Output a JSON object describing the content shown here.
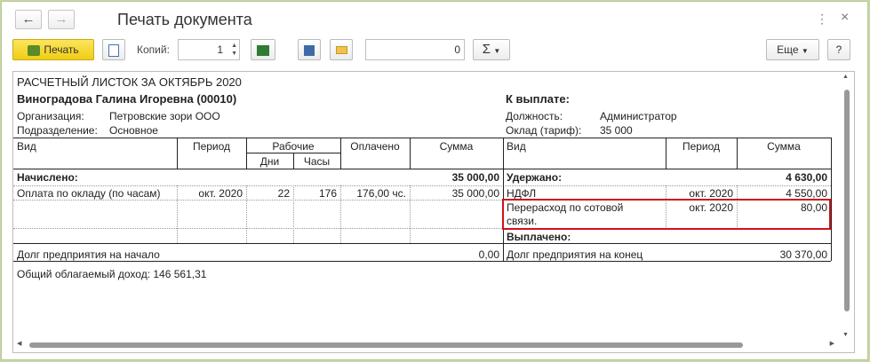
{
  "window": {
    "title": "Печать документа",
    "more_icon": "⋮",
    "close_icon": "×"
  },
  "toolbar": {
    "print_label": "Печать",
    "copies_label": "Копий:",
    "copies_value": "1",
    "sum_value": "0",
    "sigma_label": "Σ",
    "more_label": "Еще",
    "help_label": "?"
  },
  "doc": {
    "title": "РАСЧЕТНЫЙ ЛИСТОК ЗА ОКТЯБРЬ 2020",
    "employee": "Виноградова Галина Игоревна (00010)",
    "to_pay_label": "К выплате:",
    "org_label": "Организация:",
    "org_value": "Петровские зори ООО",
    "dept_label": "Подразделение:",
    "dept_value": "Основное",
    "position_label": "Должность:",
    "position_value": "Администратор",
    "salary_label": "Оклад (тариф):",
    "salary_value": "35 000",
    "headers": {
      "vid": "Вид",
      "period": "Период",
      "work": "Рабочие",
      "days": "Дни",
      "hours": "Часы",
      "paid": "Оплачено",
      "sum": "Сумма",
      "vid2": "Вид",
      "period2": "Период",
      "sum2": "Сумма"
    },
    "accrued_label": "Начислено:",
    "accrued_total": "35 000,00",
    "withheld_label": "Удержано:",
    "withheld_total": "4 630,00",
    "accrual_row": {
      "vid": "Оплата по окладу (по часам)",
      "period": "окт. 2020",
      "days": "22",
      "hours": "176",
      "paid": "176,00 чс.",
      "sum": "35 000,00"
    },
    "withhold_rows": [
      {
        "vid": "НДФЛ",
        "period": "окт. 2020",
        "sum": "4 550,00"
      },
      {
        "vid": "Перерасход по сотовой",
        "vid2": "связи.",
        "period": "окт. 2020",
        "sum": "80,00"
      }
    ],
    "paid_out_label": "Выплачено:",
    "debt_start_label": "Долг предприятия на начало",
    "debt_start_value": "0,00",
    "debt_end_label": "Долг предприятия на конец",
    "debt_end_value": "30 370,00",
    "taxable_income": "Общий облагаемый доход: 146 561,31"
  },
  "colors": {
    "print_button": "#f5d22a",
    "highlight_border": "#d0121b"
  }
}
